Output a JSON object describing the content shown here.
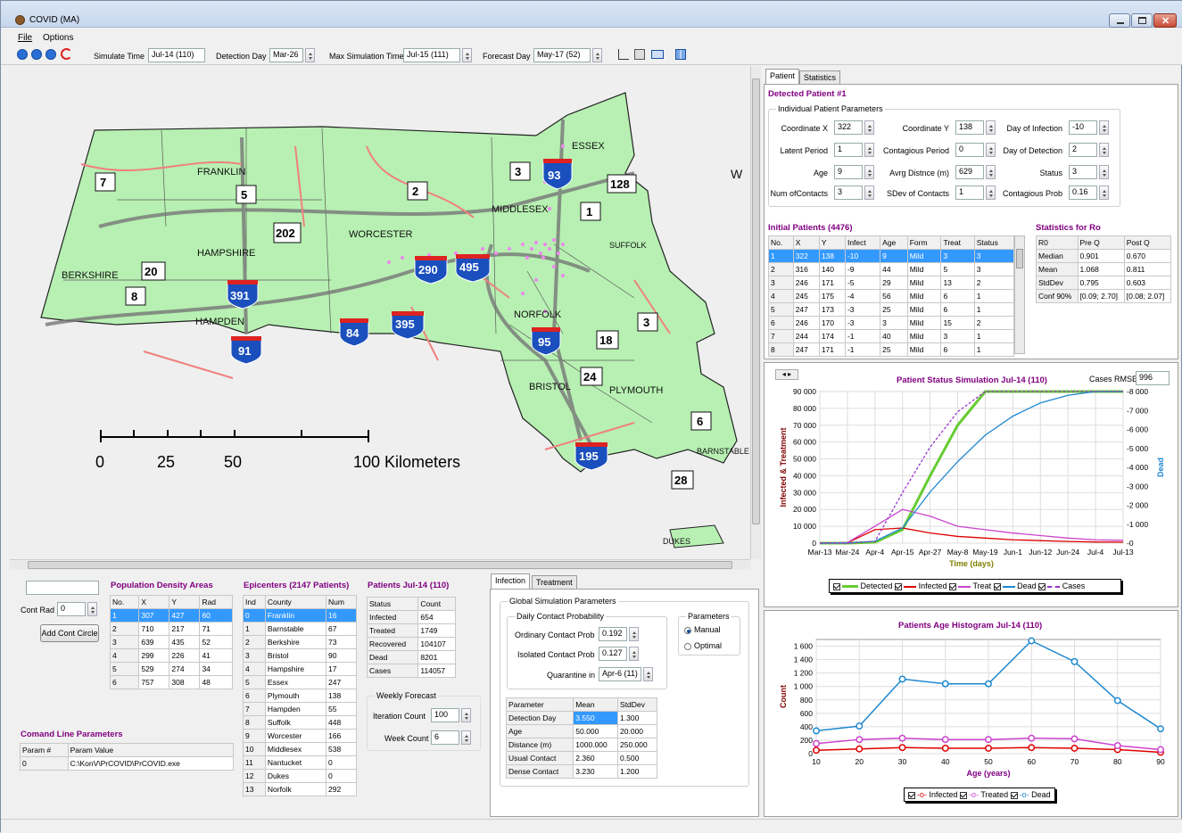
{
  "window": {
    "title": "COVID (MA)"
  },
  "menu": [
    "File",
    "Options"
  ],
  "toolbar": {
    "simulate_time_label": "Simulate Time",
    "simulate_time_value": "Jul-14 (110)",
    "detection_day_label": "Detection Day",
    "detection_day_value": "Mar-26",
    "max_sim_time_label": "Max Simulation Time",
    "max_sim_time_value": "Jul-15 (111)",
    "forecast_day_label": "Forecast Day",
    "forecast_day_value": "May-17 (52)"
  },
  "map": {
    "counties": [
      "FRANKLIN",
      "HAMPSHIRE",
      "BERKSHIRE",
      "HAMPDEN",
      "WORCESTER",
      "MIDDLESEX",
      "ESSEX",
      "SUFFOLK",
      "NORFOLK",
      "BRISTOL",
      "PLYMOUTH",
      "BARNSTABLE",
      "DUKES"
    ],
    "routes": [
      "7",
      "5",
      "202",
      "2",
      "3",
      "93",
      "128",
      "1",
      "20",
      "8",
      "391",
      "290",
      "495",
      "395",
      "84",
      "91",
      "95",
      "3",
      "18",
      "24",
      "6",
      "195",
      "28"
    ],
    "scale_ticks": [
      "0",
      "25",
      "50",
      "100 Kilometers"
    ],
    "compass_label": "W"
  },
  "left_bottom": {
    "cont_rad_label": "Cont Rad",
    "cont_rad_value": "0",
    "add_button": "Add Cont Circle",
    "cmd_title": "Comand Line Parameters",
    "cmd_headers": [
      "Param #",
      "Param Value"
    ],
    "cmd_rows": [
      [
        "0",
        "C:\\KonV\\PrCOVID\\PrCOVID.exe"
      ]
    ]
  },
  "density": {
    "title": "Population Density Areas",
    "headers": [
      "No.",
      "X",
      "Y",
      "Rad"
    ],
    "rows": [
      [
        "1",
        "307",
        "427",
        "60"
      ],
      [
        "2",
        "710",
        "217",
        "71"
      ],
      [
        "3",
        "639",
        "435",
        "52"
      ],
      [
        "4",
        "299",
        "226",
        "41"
      ],
      [
        "5",
        "529",
        "274",
        "34"
      ],
      [
        "6",
        "757",
        "308",
        "48"
      ]
    ]
  },
  "epicenters": {
    "title": "Epicenters (2147 Patients)",
    "headers": [
      "Ind",
      "County",
      "Num"
    ],
    "rows": [
      [
        "0",
        "Franklin",
        "16"
      ],
      [
        "1",
        "Barnstable",
        "67"
      ],
      [
        "2",
        "Berkshire",
        "73"
      ],
      [
        "3",
        "Bristol",
        "90"
      ],
      [
        "4",
        "Hampshire",
        "17"
      ],
      [
        "5",
        "Essex",
        "247"
      ],
      [
        "6",
        "Plymouth",
        "138"
      ],
      [
        "7",
        "Hampden",
        "55"
      ],
      [
        "8",
        "Suffolk",
        "448"
      ],
      [
        "9",
        "Worcester",
        "166"
      ],
      [
        "10",
        "Middlesex",
        "538"
      ],
      [
        "11",
        "Nantucket",
        "0"
      ],
      [
        "12",
        "Dukes",
        "0"
      ],
      [
        "13",
        "Norfolk",
        "292"
      ]
    ]
  },
  "patients_summary": {
    "title": "Patients Jul-14 (110)",
    "headers": [
      "Status",
      "Count"
    ],
    "rows": [
      [
        "Infected",
        "654"
      ],
      [
        "Treated",
        "1749"
      ],
      [
        "Recovered",
        "104107"
      ],
      [
        "Dead",
        "8201"
      ],
      [
        "Cases",
        "114057"
      ]
    ],
    "forecast_title": "Weekly Forecast",
    "iteration_label": "Iteration Count",
    "iteration_value": "100",
    "week_label": "Week Count",
    "week_value": "6"
  },
  "infection": {
    "tabs": [
      "Infection",
      "Treatment"
    ],
    "global_title": "Global Simulation Parameters",
    "daily_title": "Daily Contact Probability",
    "ordinary_label": "Ordinary Contact Prob",
    "ordinary_value": "0.192",
    "isolated_label": "Isolated Contact Prob",
    "isolated_value": "0.127",
    "quarantine_label": "Quarantine in",
    "quarantine_value": "Apr-6 (11)",
    "params_title": "Parameters",
    "manual_label": "Manual",
    "optimal_label": "Optimal",
    "table_headers": [
      "Parameter",
      "Mean",
      "StdDev"
    ],
    "table_rows": [
      [
        "Detection Day",
        "3.550",
        "1.300"
      ],
      [
        "Age",
        "50.000",
        "20.000"
      ],
      [
        "Distance (m)",
        "1000.000",
        "250.000"
      ],
      [
        "Usual Contact",
        "2.360",
        "0.500"
      ],
      [
        "Dense Contact",
        "3.230",
        "1.200"
      ]
    ]
  },
  "patient_panel": {
    "tabs": [
      "Patient",
      "Statistics"
    ],
    "title": "Detected Patient #1",
    "group_title": "Individual Patient Parameters",
    "fields": [
      {
        "label": "Coordinate X",
        "value": "322"
      },
      {
        "label": "Coordinate Y",
        "value": "138"
      },
      {
        "label": "Day of Infection",
        "value": "-10"
      },
      {
        "label": "Latent Period",
        "value": "1"
      },
      {
        "label": "Contagious Period",
        "value": "0"
      },
      {
        "label": "Day of Detection",
        "value": "2"
      },
      {
        "label": "Age",
        "value": "9"
      },
      {
        "label": "Avrg Distnce (m)",
        "value": "629"
      },
      {
        "label": "Status",
        "value": "3"
      },
      {
        "label": "Num ofContacts",
        "value": "3"
      },
      {
        "label": "SDev of Contacts",
        "value": "1"
      },
      {
        "label": "Contagious Prob",
        "value": "0.16"
      }
    ],
    "initial_title": "Initial Patients (4476)",
    "initial_headers": [
      "No.",
      "X",
      "Y",
      "Infect",
      "Age",
      "Form",
      "Treat",
      "Status"
    ],
    "initial_rows": [
      [
        "1",
        "322",
        "138",
        "-10",
        "9",
        "Mild",
        "3",
        "3"
      ],
      [
        "2",
        "316",
        "140",
        "-9",
        "44",
        "Mild",
        "5",
        "3"
      ],
      [
        "3",
        "246",
        "171",
        "-5",
        "29",
        "Mild",
        "13",
        "2"
      ],
      [
        "4",
        "245",
        "175",
        "-4",
        "56",
        "Mild",
        "6",
        "1"
      ],
      [
        "5",
        "247",
        "173",
        "-3",
        "25",
        "Mild",
        "6",
        "1"
      ],
      [
        "6",
        "246",
        "170",
        "-3",
        "3",
        "Mild",
        "15",
        "2"
      ],
      [
        "7",
        "244",
        "174",
        "-1",
        "40",
        "Mild",
        "3",
        "1"
      ],
      [
        "8",
        "247",
        "171",
        "-1",
        "25",
        "Mild",
        "6",
        "1"
      ]
    ],
    "ro_title": "Statistics for Ro",
    "ro_headers": [
      "R0",
      "Pre Q",
      "Post Q"
    ],
    "ro_rows": [
      [
        "Median",
        "0.901",
        "0.670"
      ],
      [
        "Mean",
        "1.068",
        "0.811"
      ],
      [
        "StdDev",
        "0.795",
        "0.603"
      ],
      [
        "Conf 90%",
        "[0.09; 2.70]",
        "[0.08; 2.07]"
      ]
    ]
  },
  "status_chart": {
    "title": "Patient Status Simulation Jul-14 (110)",
    "rmse_label": "Cases RMSE",
    "rmse_value": "996",
    "ylabel_left": "Infected & Treatment",
    "ylabel_right": "Dead",
    "xlabel": "Time (days)",
    "legend": [
      "Detected",
      "Infected",
      "Treat",
      "Dead",
      "Cases"
    ]
  },
  "age_chart": {
    "title": "Patients Age Histogram Jul-14 (110)",
    "xlabel": "Age (years)",
    "ylabel": "Count",
    "legend": [
      "Infected",
      "Treated",
      "Dead"
    ]
  },
  "chart_data": [
    {
      "type": "line",
      "title": "Patient Status Simulation Jul-14 (110)",
      "xlabel": "Time (days)",
      "ylabel": "Infected & Treatment",
      "y2label": "Dead",
      "x_ticks": [
        "Mar-13",
        "Mar-24",
        "Apr-4",
        "Apr-15",
        "Apr-27",
        "May-8",
        "May-19",
        "Jun-1",
        "Jun-12",
        "Jun-24",
        "Jul-4",
        "Jul-13"
      ],
      "ylim": [
        0,
        90000
      ],
      "y_ticks": [
        0,
        10000,
        20000,
        30000,
        40000,
        50000,
        60000,
        70000,
        80000,
        90000
      ],
      "y2lim": [
        0,
        8000
      ],
      "y2_ticks": [
        0,
        1000,
        2000,
        3000,
        4000,
        5000,
        6000,
        7000,
        8000
      ],
      "series": [
        {
          "name": "Detected",
          "color": "#66cc33",
          "axis": "left",
          "values": [
            0,
            0,
            500,
            8000,
            40000,
            70000,
            92000,
            96000,
            96000,
            96000,
            96000,
            96000
          ]
        },
        {
          "name": "Infected",
          "color": "#dd0000",
          "axis": "left",
          "values": [
            0,
            200,
            8000,
            9000,
            6000,
            4000,
            3000,
            2000,
            1500,
            1000,
            700,
            600
          ]
        },
        {
          "name": "Treat",
          "color": "#cc44cc",
          "axis": "left",
          "values": [
            0,
            300,
            10000,
            20000,
            16000,
            10000,
            8000,
            6000,
            4500,
            3000,
            2000,
            1700
          ]
        },
        {
          "name": "Dead",
          "color": "#1e88d0",
          "axis": "right",
          "values": [
            0,
            0,
            100,
            800,
            2700,
            4300,
            5700,
            6700,
            7400,
            7800,
            8000,
            8200
          ]
        },
        {
          "name": "Cases",
          "color": "#9933cc",
          "axis": "left",
          "values": [
            0,
            0,
            1000,
            30000,
            57000,
            78000,
            92000,
            96000,
            96000,
            96000,
            96000,
            96000
          ]
        }
      ]
    },
    {
      "type": "line",
      "title": "Patients Age Histogram Jul-14 (110)",
      "xlabel": "Age (years)",
      "ylabel": "Count",
      "x": [
        10,
        20,
        30,
        40,
        50,
        60,
        70,
        80,
        90
      ],
      "ylim": [
        0,
        1700
      ],
      "y_ticks": [
        0,
        200,
        400,
        600,
        800,
        1000,
        1200,
        1400,
        1600
      ],
      "series": [
        {
          "name": "Infected",
          "color": "#dd0000",
          "values": [
            50,
            70,
            90,
            80,
            80,
            90,
            80,
            60,
            20
          ]
        },
        {
          "name": "Treated",
          "color": "#cc44cc",
          "values": [
            150,
            210,
            230,
            210,
            210,
            230,
            220,
            120,
            60
          ]
        },
        {
          "name": "Dead",
          "color": "#1e88d0",
          "values": [
            340,
            410,
            1110,
            1040,
            1040,
            1680,
            1370,
            790,
            370
          ]
        }
      ]
    }
  ]
}
